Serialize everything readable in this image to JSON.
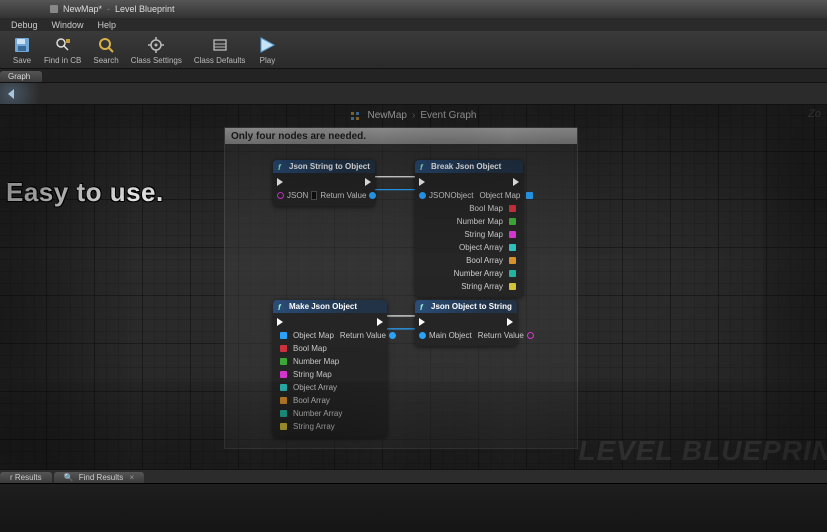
{
  "window": {
    "title_a": "NewMap*",
    "title_b": "Level Blueprint"
  },
  "menu": {
    "items": [
      "Debug",
      "Window",
      "Help"
    ]
  },
  "toolbar": {
    "save": "Save",
    "find_in_cb": "Find in CB",
    "search": "Search",
    "class_settings": "Class Settings",
    "class_defaults": "Class Defaults",
    "play": "Play"
  },
  "tabs": {
    "graph": "Graph"
  },
  "breadcrumb": {
    "a": "NewMap",
    "b": "Event Graph"
  },
  "zoom": "Zo",
  "promo": "Easy to use.",
  "panel": {
    "title": "Only four nodes are needed."
  },
  "nodes": {
    "n1": {
      "title": "Json String to Object",
      "json_label": "JSON",
      "json_value": "",
      "out": "Return Value"
    },
    "n2": {
      "title": "Break Json Object",
      "in": "JSONObject",
      "outs": [
        "Object Map",
        "Bool Map",
        "Number Map",
        "String Map",
        "Object Array",
        "Bool Array",
        "Number Array",
        "String Array"
      ]
    },
    "n3": {
      "title": "Make Json Object",
      "out": "Return Value",
      "ins": [
        "Object Map",
        "Bool Map",
        "Number Map",
        "String Map",
        "Object Array",
        "Bool Array",
        "Number Array",
        "String Array"
      ]
    },
    "n4": {
      "title": "Json Object to String",
      "in": "Main Object",
      "out": "Return Value"
    }
  },
  "watermark": "LEVEL BLUEPRIN",
  "results": {
    "tab1": "r Results",
    "tab2": "Find Results"
  },
  "chart_data": null
}
